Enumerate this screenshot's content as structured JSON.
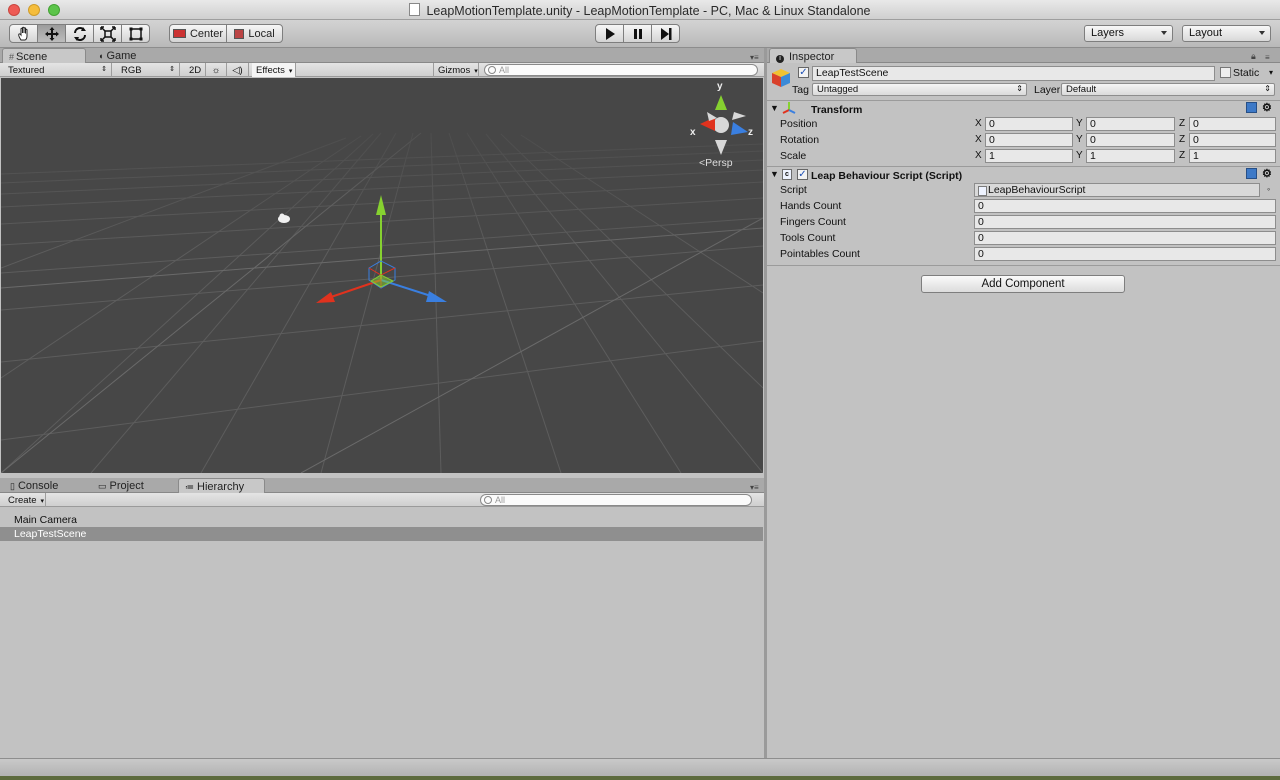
{
  "window": {
    "title": "LeapMotionTemplate.unity - LeapMotionTemplate - PC, Mac & Linux Standalone"
  },
  "toolbar": {
    "tools": [
      "hand-tool",
      "move-tool",
      "rotate-tool",
      "scale-tool",
      "rect-tool"
    ],
    "pivot_label": "Center",
    "space_label": "Local",
    "layers_label": "Layers",
    "layout_label": "Layout"
  },
  "scene": {
    "tabs": [
      {
        "label": "Scene",
        "active": true
      },
      {
        "label": "Game",
        "active": false
      }
    ],
    "render_mode": "Textured",
    "color_mode": "RGB",
    "mode_2d": "2D",
    "effects": "Effects",
    "gizmos": "Gizmos",
    "search_placeholder": "All",
    "persp_label": "Persp",
    "gizmo_axes": {
      "x": "x",
      "y": "y",
      "z": "z"
    }
  },
  "bottom": {
    "tabs": [
      {
        "label": "Console",
        "active": false
      },
      {
        "label": "Project",
        "active": false
      },
      {
        "label": "Hierarchy",
        "active": true
      }
    ],
    "create_label": "Create",
    "search_placeholder": "All",
    "items": [
      {
        "label": "Main Camera",
        "selected": false
      },
      {
        "label": "LeapTestScene",
        "selected": true
      }
    ]
  },
  "inspector": {
    "tab_label": "Inspector",
    "object_name": "LeapTestScene",
    "static_label": "Static",
    "tag_label": "Tag",
    "tag_value": "Untagged",
    "layer_label": "Layer",
    "layer_value": "Default",
    "transform": {
      "title": "Transform",
      "rows": [
        {
          "label": "Position",
          "x": "0",
          "y": "0",
          "z": "0"
        },
        {
          "label": "Rotation",
          "x": "0",
          "y": "0",
          "z": "0"
        },
        {
          "label": "Scale",
          "x": "1",
          "y": "1",
          "z": "1"
        }
      ],
      "axis_x": "X",
      "axis_y": "Y",
      "axis_z": "Z"
    },
    "script_component": {
      "title": "Leap Behaviour Script (Script)",
      "script_label": "Script",
      "script_value": "LeapBehaviourScript",
      "fields": [
        {
          "label": "Hands Count",
          "value": "0"
        },
        {
          "label": "Fingers Count",
          "value": "0"
        },
        {
          "label": "Tools Count",
          "value": "0"
        },
        {
          "label": "Pointables Count",
          "value": "0"
        }
      ]
    },
    "add_component_label": "Add Component"
  },
  "colors": {
    "scene_bg": "#474747",
    "selection": "#8f8f8f",
    "axis_x": "#e0321e",
    "axis_y": "#86d130",
    "axis_z": "#3a7fe0"
  }
}
